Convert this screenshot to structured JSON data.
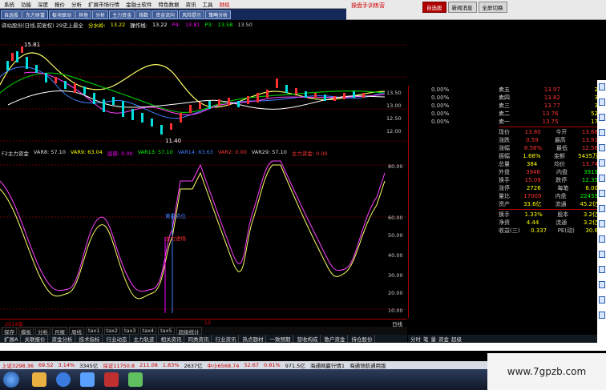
{
  "menubar": {
    "items": [
      "系统",
      "功能",
      "深度",
      "报价",
      "分析",
      "扩展市场行情",
      "金融士软件",
      "特色数据",
      "资讯",
      "工具",
      "财经"
    ],
    "brand": "操盘手训练营",
    "buttons": [
      "自选股",
      "新闻消息",
      "全屏切换"
    ]
  },
  "toolbar": {
    "buttons": [
      "自选股",
      "东方财富",
      "板块联动",
      "其他",
      "分析",
      "主力资金",
      "指数",
      "资金流向",
      "风险提示",
      "策略分析"
    ]
  },
  "chart_header": {
    "title": "驿站股份(日线,前复权) 29史上最全",
    "label1": "分水岭:",
    "value1": "13.22",
    "label2": "操作线:",
    "value2": "13.22",
    "label3": "P4:",
    "value3": "13.81",
    "label4": "P3:",
    "value4": "13.58",
    "label5": "",
    "value5": "13.50"
  },
  "chart": {
    "high_label": "15.81",
    "low_label": "11.40",
    "yaxis": [
      "13.50",
      "13.00",
      "12.50",
      "12.00"
    ]
  },
  "indicator_header": {
    "name": "F2主力资金",
    "items": [
      "VAR8: 57.10",
      "VAR9: 63.04",
      "底部: 0.00",
      "VAR13: 57.10",
      "VAR14: 63.63",
      "VAR2: 0.00",
      "VAR29: 57.10",
      "主力资金: 0.00"
    ]
  },
  "indicator": {
    "yaxis": [
      "80.00",
      "60.00",
      "50.00",
      "40.00",
      "30.00",
      "20.00",
      "10.00"
    ],
    "label_blue": "黄金点位",
    "label_red": "主力进场"
  },
  "orderbook": {
    "sell": [
      {
        "l": "卖五",
        "p": "13.97",
        "v": "2"
      },
      {
        "l": "卖四",
        "p": "13.82",
        "v": "3"
      },
      {
        "l": "卖三",
        "p": "13.77",
        "v": "3"
      },
      {
        "l": "卖二",
        "p": "13.76",
        "v": "52"
      },
      {
        "l": "卖一",
        "p": "13.75",
        "v": "17"
      }
    ],
    "stats": [
      {
        "a": "现价",
        "av": "13.80",
        "b": "今开",
        "bv": "13.68"
      },
      {
        "a": "涨跌",
        "av": "0.59",
        "b": "最高",
        "bv": "13.91"
      },
      {
        "a": "涨幅",
        "av": "8.58%",
        "b": "最低",
        "bv": "12.56"
      },
      {
        "a": "振幅",
        "av": "1.68%",
        "b": "金额",
        "bv": "5435万"
      },
      {
        "a": "总量",
        "av": "384",
        "b": "均价",
        "bv": "13.74"
      },
      {
        "a": "外盘",
        "av": "3946",
        "b": "内盘",
        "bv": "3919"
      },
      {
        "a": "换手",
        "av": "15.09",
        "b": "跌停",
        "bv": "12.35"
      },
      {
        "a": "涨停",
        "av": "2726",
        "b": "每笔",
        "bv": "6.00"
      },
      {
        "a": "量比",
        "av": "17009",
        "b": "内盘",
        "bv": "22455"
      },
      {
        "a": "资产",
        "av": "33.6亿",
        "b": "流通",
        "bv": "45.2亿"
      }
    ],
    "bottom": [
      {
        "a": "换手",
        "av": "1.33%",
        "b": "股本",
        "bv": "3.2亿"
      },
      {
        "a": "净资",
        "av": "4.44",
        "b": "流通",
        "bv": "3.2亿"
      },
      {
        "a": "收益(三)",
        "av": "0.337",
        "b": "PE(动)",
        "bv": "30.6"
      }
    ]
  },
  "percent_col": [
    "0.00%",
    "0.00%",
    "0.00%",
    "0.00%",
    "0.00%"
  ],
  "xaxis": {
    "left": "2014年",
    "mid": "12",
    "right": "日线"
  },
  "tabs1": [
    "保存",
    "模板",
    "分析",
    "月报",
    "周线",
    "tax1",
    "tax2",
    "tax3",
    "tax4",
    "tax5",
    "超级统计"
  ],
  "tabs2": [
    "扩展A",
    "关联报价",
    "资金分析",
    "技术指标",
    "行业动态",
    "主力轨迹",
    "相关资讯",
    "同类资讯",
    "行业资讯",
    "热点题材",
    "一致预期",
    "营收构成",
    "散户资金",
    "持仓股份"
  ],
  "rtabs": [
    "分时",
    "笔",
    "量",
    "资金",
    "超级"
  ],
  "statusbar": {
    "items": [
      "上证3298.36",
      "69.52",
      "3.14%",
      "3345亿",
      "深证11750.8",
      "211.08",
      "1.83%",
      "2637亿",
      "中小6568.74",
      "52.67",
      "0.81%",
      "971.5亿"
    ],
    "right": "海通网赢行情1",
    "right2": "海通领航通用版"
  },
  "watermark": "www.7gpzb.com"
}
